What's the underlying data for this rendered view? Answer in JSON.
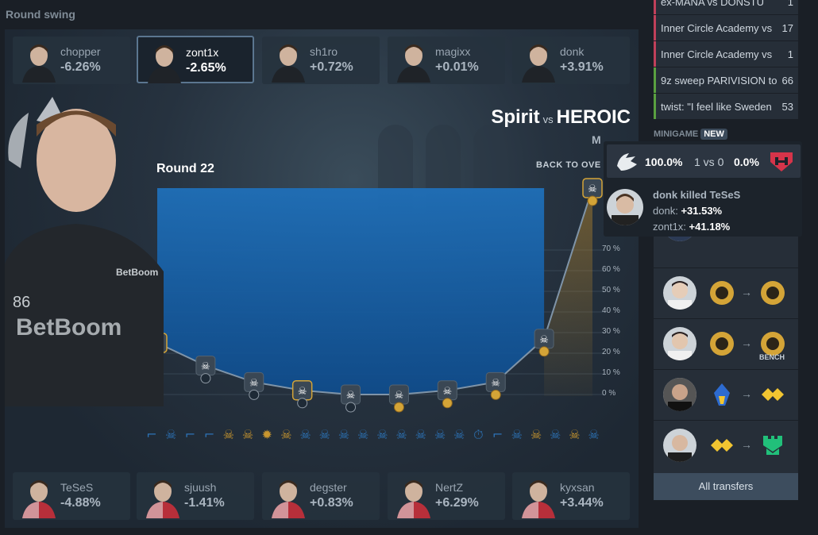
{
  "section_title": "Round swing",
  "top_players": [
    {
      "name": "chopper",
      "value": "-6.26%",
      "selected": false
    },
    {
      "name": "zont1x",
      "value": "-2.65%",
      "selected": true
    },
    {
      "name": "sh1ro",
      "value": "+0.72%",
      "selected": false
    },
    {
      "name": "magixx",
      "value": "+0.01%",
      "selected": false
    },
    {
      "name": "donk",
      "value": "+3.91%",
      "selected": false
    }
  ],
  "bottom_players": [
    {
      "name": "TeSeS",
      "value": "-4.88%"
    },
    {
      "name": "sjuush",
      "value": "-1.41%"
    },
    {
      "name": "degster",
      "value": "+0.83%"
    },
    {
      "name": "NertZ",
      "value": "+6.29%"
    },
    {
      "name": "kyxsan",
      "value": "+3.44%"
    }
  ],
  "match": {
    "team1": "Spirit",
    "vs": "vs",
    "team2": "HEROIC",
    "map_partial": "M",
    "back_label": "BACK TO OVE"
  },
  "round_label": "Round 22",
  "chart_data": {
    "type": "line",
    "y_ticks": [
      "0 %",
      "10 %",
      "20 %",
      "30 %",
      "40 %",
      "50 %",
      "60 %",
      "70 %"
    ],
    "ylim": [
      0,
      100
    ],
    "x": [
      0,
      1,
      2,
      3,
      4,
      5,
      6,
      7,
      8,
      9
    ],
    "values": [
      25,
      14,
      6,
      2,
      0,
      0,
      2,
      6,
      27,
      100
    ],
    "marker_icons": [
      "dollar",
      "skull",
      "skull",
      "skull",
      "skull",
      "skull",
      "skull",
      "skull",
      "skull",
      "skull"
    ],
    "highlighted_index": 3
  },
  "timeline_icons": [
    "gun",
    "skull-blue",
    "gun",
    "gun",
    "skull-gold",
    "skull-gold",
    "explosion",
    "skull-gold",
    "skull-blue",
    "skull-blue",
    "skull-blue",
    "skull-blue",
    "skull-blue",
    "skull-blue",
    "skull-blue",
    "skull-blue",
    "skull-blue",
    "timer",
    "gun",
    "skull-blue",
    "skull-gold",
    "skull-blue",
    "skull-gold",
    "skull-blue"
  ],
  "news": [
    {
      "title": "ex-MANA vs DONSTU",
      "count": "1",
      "color": "#c0405a"
    },
    {
      "title": "Inner Circle Academy vs",
      "count": "17",
      "color": "#c0405a"
    },
    {
      "title": "Inner Circle Academy vs",
      "count": "1",
      "color": "#c0405a"
    },
    {
      "title": "9z sweep PARIVISION to",
      "count": "66",
      "color": "#5aa040"
    },
    {
      "title": "twist: \"I feel like Sweden",
      "count": "53",
      "color": "#5aa040"
    }
  ],
  "minigame": {
    "label": "MINIGAME",
    "badge": "NEW"
  },
  "tooltip": {
    "left_pct": "100.0%",
    "score": "1 vs 0",
    "right_pct": "0.0%",
    "event": "donk killed TeSeS",
    "line1_label": "donk:",
    "line1_value": "+31.53%",
    "line2_label": "zont1x:",
    "line2_value": "+41.18%"
  },
  "transfers": {
    "bench_label": "BENCH",
    "all_label": "All transfers",
    "arrow": "→"
  },
  "colors": {
    "accent_gold": "#d4a437",
    "line": "#7f94a8",
    "area_top": "#1f6fb8"
  }
}
